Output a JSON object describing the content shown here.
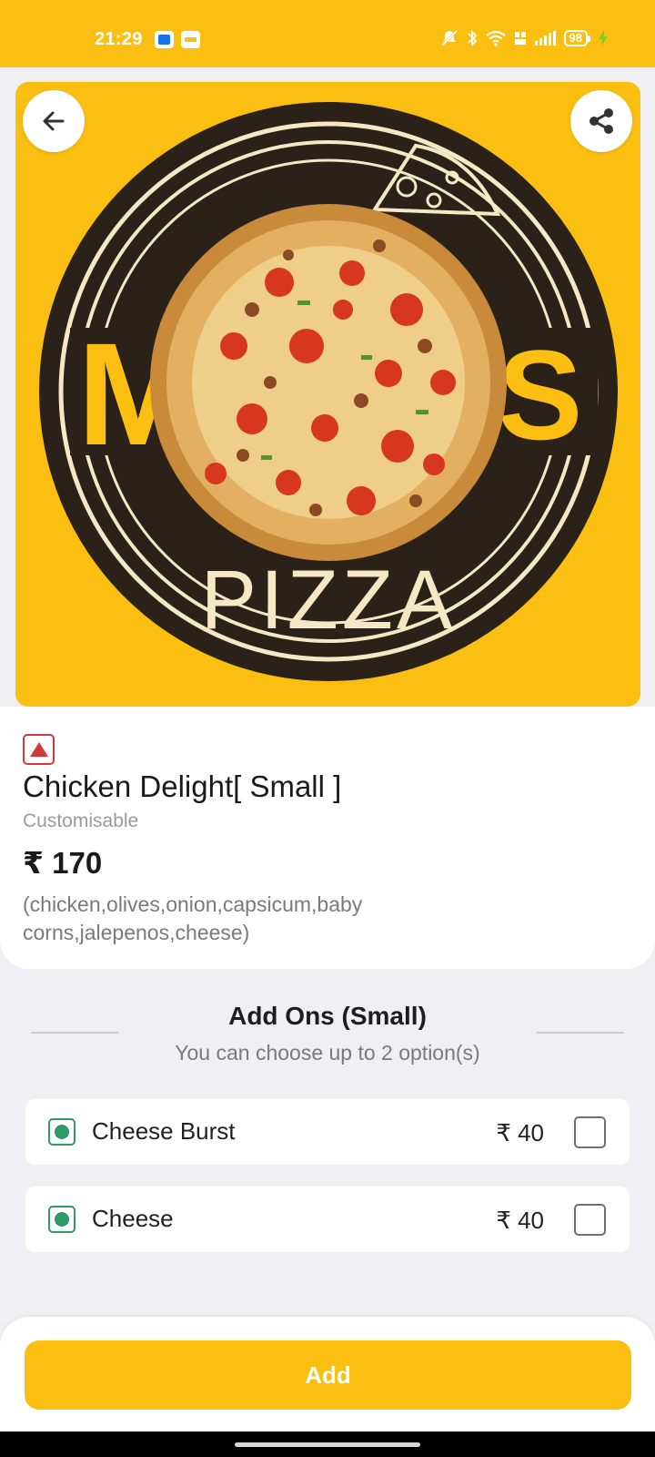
{
  "status_bar": {
    "time": "21:29",
    "battery": "98",
    "icons": [
      "notification-app-icon",
      "sale-app-icon",
      "mute-icon",
      "bluetooth-icon",
      "wifi-icon",
      "volte-icon",
      "signal-icon",
      "battery-icon",
      "charging-icon"
    ]
  },
  "hero": {
    "image_text": "PIZZA",
    "back_icon": "arrow-left-icon",
    "share_icon": "share-icon"
  },
  "item": {
    "type_icon": "non-veg-icon",
    "title": "Chicken Delight[ Small ]",
    "customisable": "Customisable",
    "price": "₹ 170",
    "description": "(chicken,olives,onion,capsicum,baby corns,jalepenos,cheese)"
  },
  "addons": {
    "title": "Add Ons (Small)",
    "subtitle": "You can choose up to 2 option(s)",
    "options": [
      {
        "name": "Cheese Burst",
        "price": "₹ 40",
        "checked": false
      },
      {
        "name": "Cheese",
        "price": "₹ 40",
        "checked": false
      }
    ]
  },
  "footer": {
    "add_label": "Add"
  },
  "colors": {
    "accent": "#fbbf12",
    "veg": "#2e9b63",
    "non_veg": "#d23a3a",
    "background": "#efeff4"
  }
}
